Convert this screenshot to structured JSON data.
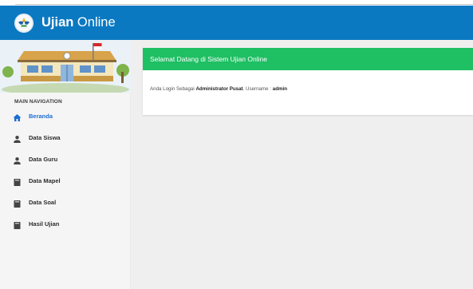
{
  "app": {
    "title_bold": "Ujian",
    "title_rest": " Online"
  },
  "sidebar": {
    "nav_header": "MAIN NAVIGATION",
    "items": [
      {
        "label": "Beranda",
        "icon": "home-icon",
        "active": true
      },
      {
        "label": "Data Siswa",
        "icon": "user-icon",
        "active": false
      },
      {
        "label": "Data Guru",
        "icon": "user-icon",
        "active": false
      },
      {
        "label": "Data Mapel",
        "icon": "book-icon",
        "active": false
      },
      {
        "label": "Data Soal",
        "icon": "book-icon",
        "active": false
      },
      {
        "label": "Hasil Ujian",
        "icon": "book-icon",
        "active": false
      }
    ]
  },
  "welcome": {
    "title": "Selamat Datang di Sistem Ujian Online",
    "login_prefix": "Anda Login Sebagai ",
    "role": "Administrator Pusat",
    "username_prefix": ". Username : ",
    "username": "admin"
  },
  "colors": {
    "header": "#0a79c2",
    "card_header": "#1fbf63",
    "active_nav": "#1b6fd1",
    "content_bg": "#efefef",
    "sidebar_bg": "#f5f5f5"
  }
}
